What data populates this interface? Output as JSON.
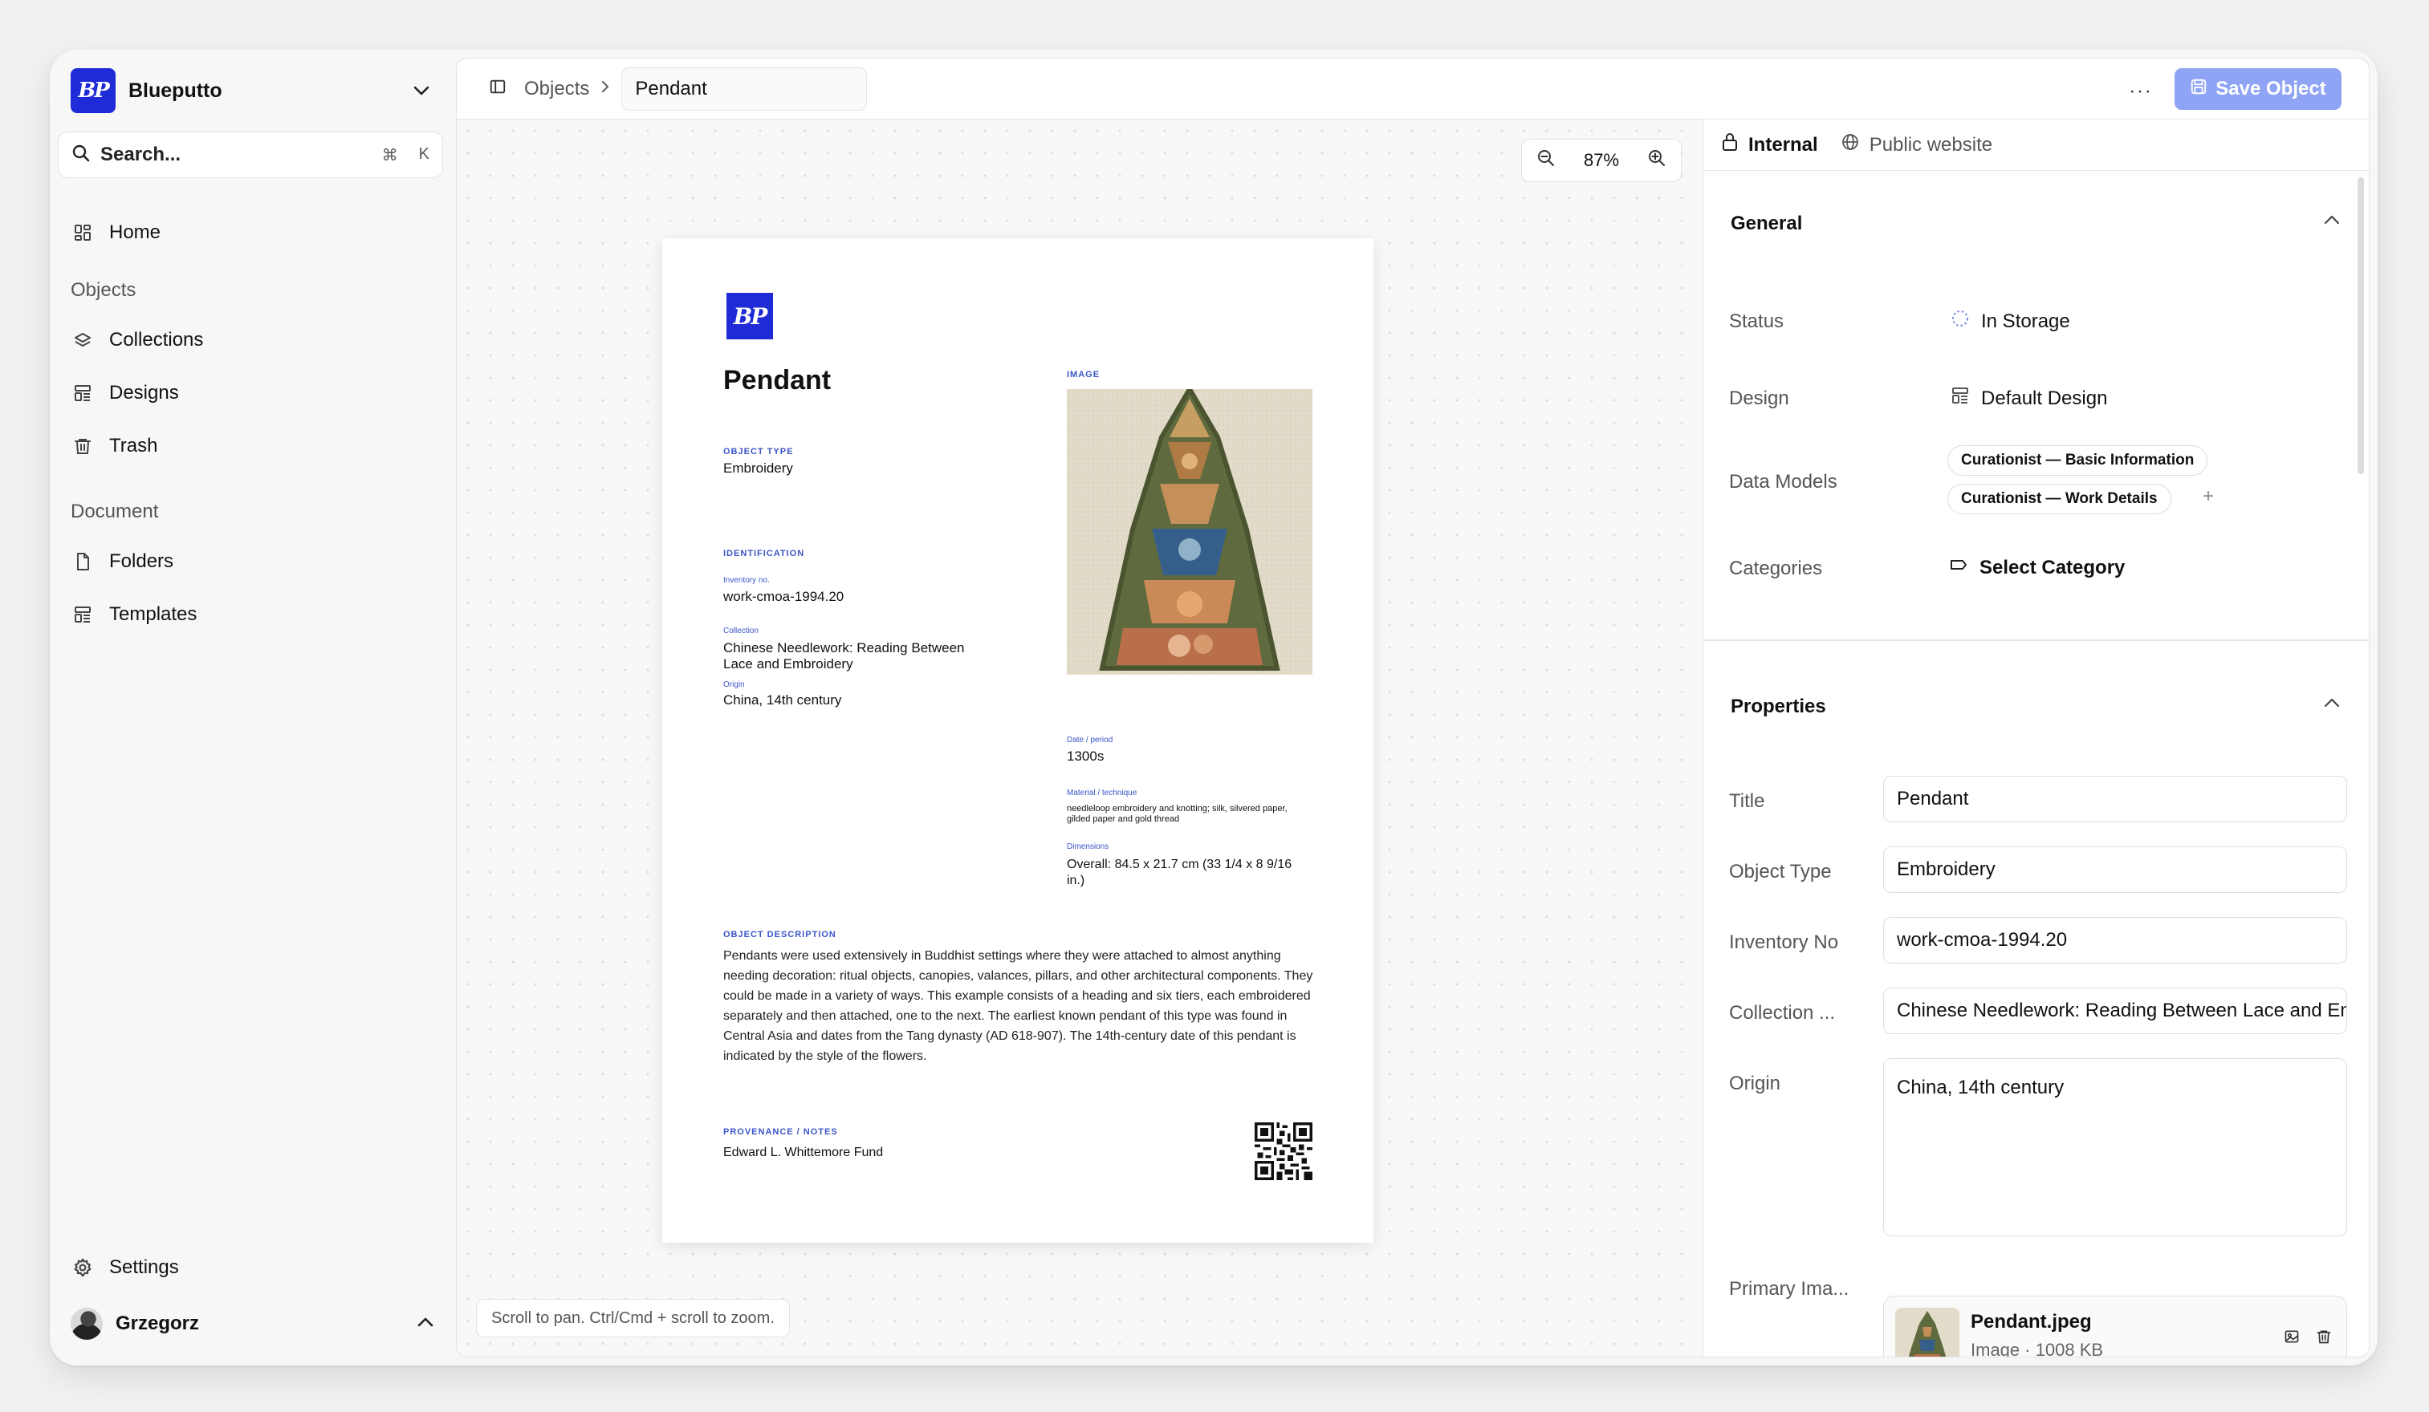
{
  "app": {
    "name": "Blueputto",
    "logo_text": "BP"
  },
  "search": {
    "label": "Search...",
    "shortcut_mod": "⌘",
    "shortcut_key": "K"
  },
  "sidebar": {
    "home": "Home",
    "group_objects": "Objects",
    "collections": "Collections",
    "designs": "Designs",
    "trash": "Trash",
    "group_document": "Document",
    "folders": "Folders",
    "templates": "Templates",
    "settings": "Settings",
    "user": "Grzegorz"
  },
  "topbar": {
    "crumb_parent": "Objects",
    "crumb_current": "Pendant",
    "more": "···",
    "save_label": "Save Object"
  },
  "canvas": {
    "zoom": "87%",
    "hint": "Scroll to pan. Ctrl/Cmd + scroll to zoom."
  },
  "paper": {
    "logo_text": "BP",
    "title": "Pendant",
    "object_type_label": "OBJECT TYPE",
    "object_type": "Embroidery",
    "identification_label": "IDENTIFICATION",
    "inventory_label": "Inventory no.",
    "inventory": "work-cmoa-1994.20",
    "collection_label": "Collection",
    "collection": "Chinese Needlework: Reading Between Lace and Embroidery",
    "origin_label": "Origin",
    "origin": "China, 14th century",
    "image_label": "IMAGE",
    "date_label": "Date / period",
    "date": "1300s",
    "material_label": "Material / technique",
    "material": "needleloop embroidery and knotting; silk, silvered paper, gilded paper and gold thread",
    "dimensions_label": "Dimensions",
    "dimensions": "Overall: 84.5 x 21.7 cm (33 1/4 x 8 9/16 in.)",
    "description_label": "OBJECT DESCRIPTION",
    "description": "Pendants were used extensively in Buddhist settings where they were attached to almost anything needing decoration: ritual objects, canopies, valances, pillars, and other architectural components. They could be made in a variety of ways. This example consists of a heading and six tiers, each embroidered separately and then attached, one to the next. The earliest known pendant of this type was found in Central Asia and dates from the Tang dynasty (AD 618-907). The 14th-century date of this pendant is indicated by the style of the flowers.",
    "provenance_label": "PROVENANCE / NOTES",
    "provenance": "Edward L. Whittemore Fund"
  },
  "panel": {
    "tab_internal": "Internal",
    "tab_public": "Public website",
    "general_title": "General",
    "status_label": "Status",
    "status_value": "In Storage",
    "design_label": "Design",
    "design_value": "Default Design",
    "data_models_label": "Data Models",
    "data_models": [
      "Curationist — Basic Information",
      "Curationist — Work Details"
    ],
    "add_model": "+",
    "categories_label": "Categories",
    "categories_value": "Select Category",
    "properties_title": "Properties",
    "title_label": "Title",
    "title_value": "Pendant",
    "object_type_label": "Object Type",
    "object_type_value": "Embroidery",
    "inventory_label": "Inventory No",
    "inventory_value": "work-cmoa-1994.20",
    "collection_label": "Collection ...",
    "collection_value": "Chinese Needlework: Reading Between Lace and Embroidery",
    "origin_label": "Origin",
    "origin_value": "China, 14th century",
    "primary_image_label": "Primary Ima...",
    "file_name": "Pendant.jpeg",
    "file_meta": "Image · 1008 KB"
  },
  "colors": {
    "accent": "#1f2bd6",
    "save_button": "#8fa4f4",
    "label_blue": "#3a55c8"
  },
  "icons": [
    "chevron-down-icon",
    "search-icon",
    "home-icon",
    "layers-icon",
    "designs-icon",
    "trash-icon",
    "file-icon",
    "templates-icon",
    "gear-icon",
    "sidebar-toggle-icon",
    "chevron-right-icon",
    "save-icon",
    "zoom-out-icon",
    "zoom-in-icon",
    "lock-icon",
    "globe-icon",
    "chevron-up-icon",
    "loader-icon",
    "tag-icon",
    "image-icon",
    "delete-icon"
  ]
}
